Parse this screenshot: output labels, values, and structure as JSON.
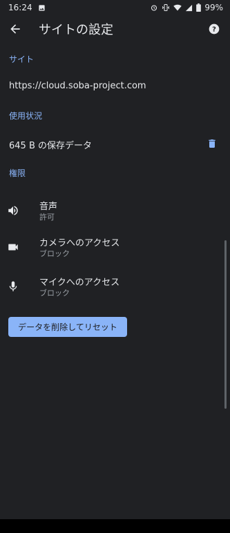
{
  "status_bar": {
    "time": "16:24",
    "battery": "99%",
    "icons": [
      "image-icon",
      "alarm-icon",
      "vibrate-icon",
      "wifi-icon",
      "signal-icon",
      "battery-icon"
    ]
  },
  "toolbar": {
    "title": "サイトの設定",
    "back_icon": "arrow-back-icon",
    "help_icon": "help-icon"
  },
  "site_section": {
    "header": "サイト",
    "url": "https://cloud.soba-project.com"
  },
  "usage_section": {
    "header": "使用状況",
    "storage_text": "645 B の保存データ",
    "delete_icon": "trash-icon"
  },
  "permissions_section": {
    "header": "権限",
    "items": [
      {
        "label": "音声",
        "status": "許可",
        "icon": "volume-icon"
      },
      {
        "label": "カメラへのアクセス",
        "status": "ブロック",
        "icon": "videocam-icon"
      },
      {
        "label": "マイクへのアクセス",
        "status": "ブロック",
        "icon": "mic-icon"
      }
    ]
  },
  "reset_button": {
    "label": "データを削除してリセット"
  },
  "colors": {
    "background": "#202124",
    "accent": "#8ab4f8",
    "text": "#e8eaed",
    "secondary_text": "#9aa0a6"
  }
}
